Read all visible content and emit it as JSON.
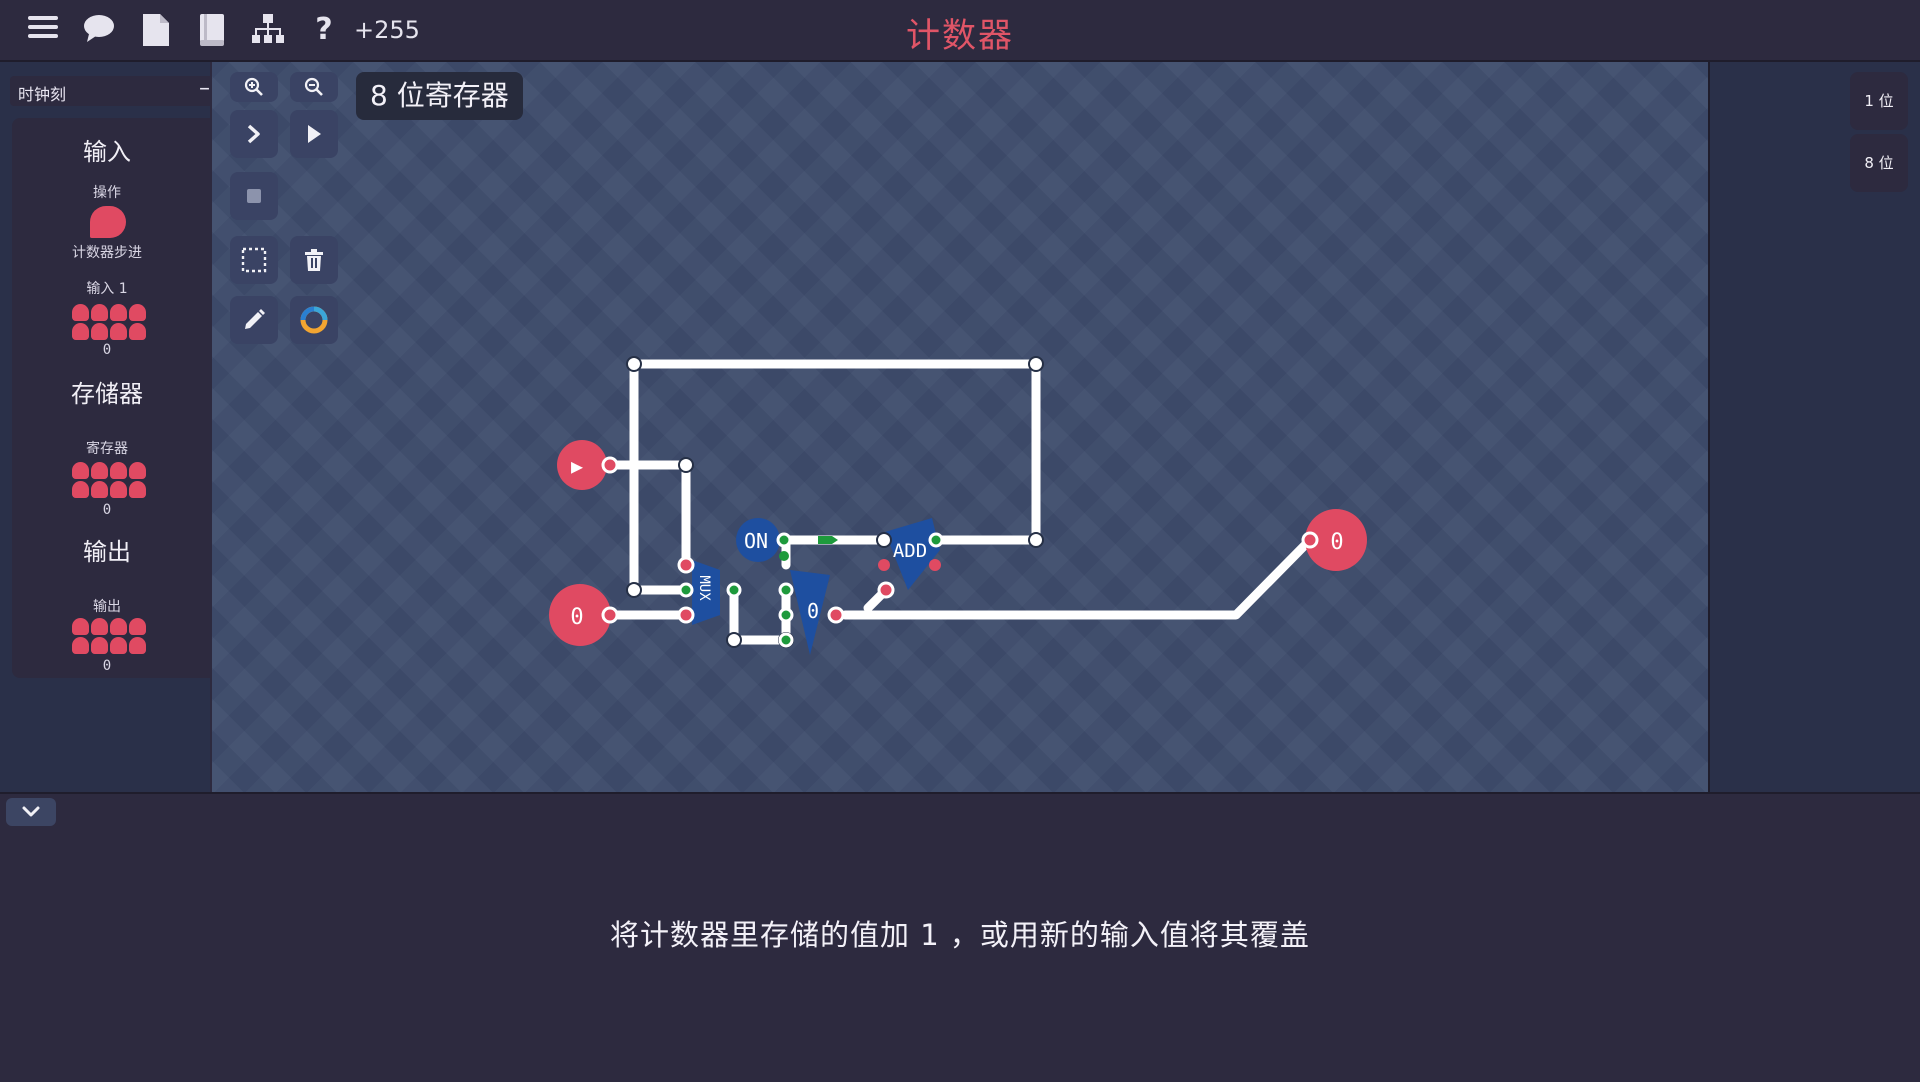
{
  "topbar": {
    "icons": [
      "menu-icon",
      "chat-icon",
      "file-icon",
      "book-icon",
      "hierarchy-icon",
      "help-icon"
    ],
    "help_glyph": "?",
    "score": "+255",
    "title": "计数器"
  },
  "left_panel": {
    "clock_label": "时钟刻",
    "clock_button": "–",
    "sections": {
      "input": {
        "title": "输入",
        "items": {
          "action_label": "操作",
          "step_label": "计数器步进",
          "input1_label": "输入 1",
          "input1_value": "0"
        }
      },
      "storage": {
        "title": "存储器",
        "register_label": "寄存器",
        "register_value": "0"
      },
      "output": {
        "title": "输出",
        "output_label": "输出",
        "output_value": "0"
      }
    }
  },
  "tools": [
    "zoom-in-icon",
    "zoom-out-icon",
    "step-forward-icon",
    "play-icon",
    "stop-icon",
    "select-area-icon",
    "trash-icon",
    "pencil-icon",
    "color-wheel-icon"
  ],
  "canvas": {
    "title": "8 位寄存器",
    "nodes": {
      "input_play_glyph": "▶",
      "input_value": "0",
      "on_label": "ON",
      "mux_label": "MUX",
      "register_value": "0",
      "add_label": "ADD",
      "output_value": "0"
    }
  },
  "right_panel": {
    "buttons": [
      "1 位",
      "8 位"
    ]
  },
  "colors": {
    "accent_red": "#e04a62",
    "title_red": "#e05567",
    "canvas_bg": "#3e4c6c",
    "wire": "#ffffff",
    "node_blue": "#1e4fa0",
    "signal_green": "#1e9a3c"
  },
  "bottom": {
    "collapse_icon": "chevron-down-icon",
    "description": "将计数器里存储的值加 1 ，或用新的输入值将其覆盖"
  }
}
